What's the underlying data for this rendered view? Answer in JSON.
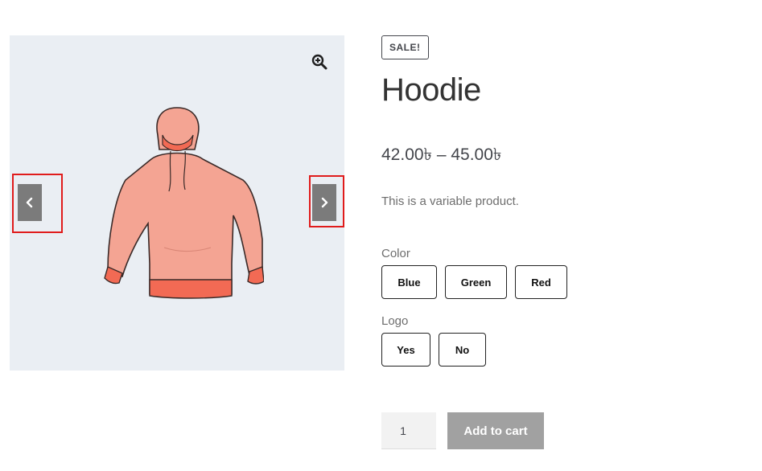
{
  "gallery": {
    "zoom_icon": "magnifier-plus-icon",
    "prev_icon": "chevron-left-icon",
    "next_icon": "chevron-right-icon",
    "image_alt": "hoodie-image"
  },
  "product": {
    "badge": "SALE!",
    "title": "Hoodie",
    "price": "42.00৳ – 45.00৳",
    "description": "This is a variable product."
  },
  "attributes": {
    "color": {
      "label": "Color",
      "options": [
        "Blue",
        "Green",
        "Red"
      ]
    },
    "logo": {
      "label": "Logo",
      "options": [
        "Yes",
        "No"
      ]
    }
  },
  "cart": {
    "quantity": "1",
    "button": "Add to cart"
  },
  "colors": {
    "gallery_bg": "#eaeef3",
    "nav_button": "#7b7b7b",
    "highlight": "#e01b1b",
    "cart_button": "#a1a1a1",
    "hoodie": "#f4a493"
  }
}
